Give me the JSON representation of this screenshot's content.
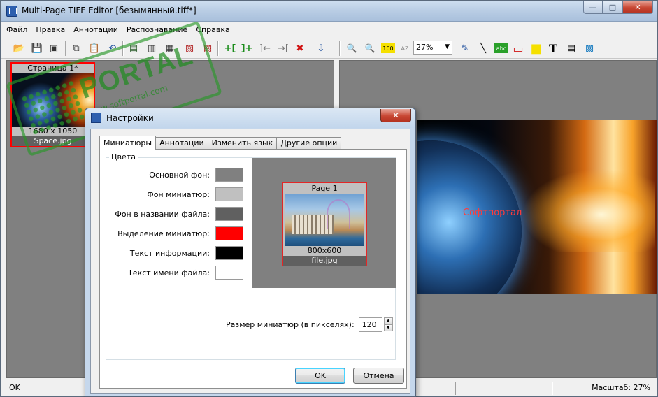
{
  "window": {
    "title": "Multi-Page TIFF Editor [безымянный.tiff*]",
    "caption_buttons": {
      "minimize": "—",
      "maximize": "□",
      "close": "✕"
    }
  },
  "menu": [
    "Файл",
    "Правка",
    "Аннотации",
    "Распознавание",
    "Справка"
  ],
  "toolbar": {
    "zoom_value": "27%",
    "zoom_dropdown_icon": "▼",
    "glyphs": {
      "open": "📂",
      "save": "💾",
      "scan": "▣",
      "copy": "⧉",
      "paste": "📋",
      "undo": "↶",
      "page_a": "▤",
      "page_b": "▥",
      "page_c": "▦",
      "page_d": "▧",
      "page_e": "▨",
      "add": "+[",
      "add_after": "]+",
      "move_left": "]←",
      "move_right": "→[",
      "delete": "✖",
      "export": "⇩",
      "zoom_out": "🔍",
      "zoom_in": "🔍",
      "zoom_100": "100",
      "zoom_az": "AZ",
      "pen": "✎",
      "line": "╲",
      "abc": "abc",
      "rect_red": "▭",
      "rect_yellow": "■",
      "text": "T",
      "note": "▤",
      "image": "▩"
    }
  },
  "thumbnail": {
    "title": "Страница 1*",
    "info": "1680 x 1050",
    "filename": "Space.jpg"
  },
  "watermark": {
    "big": "PORTAL",
    "small": "www.softportal.com"
  },
  "canvas": {
    "caption": "Софтпортал"
  },
  "status": {
    "left": "OK",
    "right": "Масштаб: 27%"
  },
  "dialog": {
    "title": "Настройки",
    "close": "✕",
    "tabs": [
      "Миниатюры",
      "Аннотации",
      "Изменить язык",
      "Другие опции"
    ],
    "active_tab": 0,
    "group_label": "Цвета",
    "color_rows": [
      {
        "label": "Основной фон:",
        "color": "#808080"
      },
      {
        "label": "Фон миниатюр:",
        "color": "#c0c0c0"
      },
      {
        "label": "Фон в названии файла:",
        "color": "#606060"
      },
      {
        "label": "Выделение миниатюр:",
        "color": "#ff0000"
      },
      {
        "label": "Текст информации:",
        "color": "#000000"
      },
      {
        "label": "Текст имени файла:",
        "color": "#ffffff"
      }
    ],
    "preview": {
      "title": "Page 1",
      "info": "800x600",
      "filename": "file.jpg"
    },
    "size_label": "Размер миниатюр (в пикселях):",
    "size_value": "120",
    "spin_up": "▲",
    "spin_down": "▼",
    "ok": "OK",
    "cancel": "Отмена"
  }
}
